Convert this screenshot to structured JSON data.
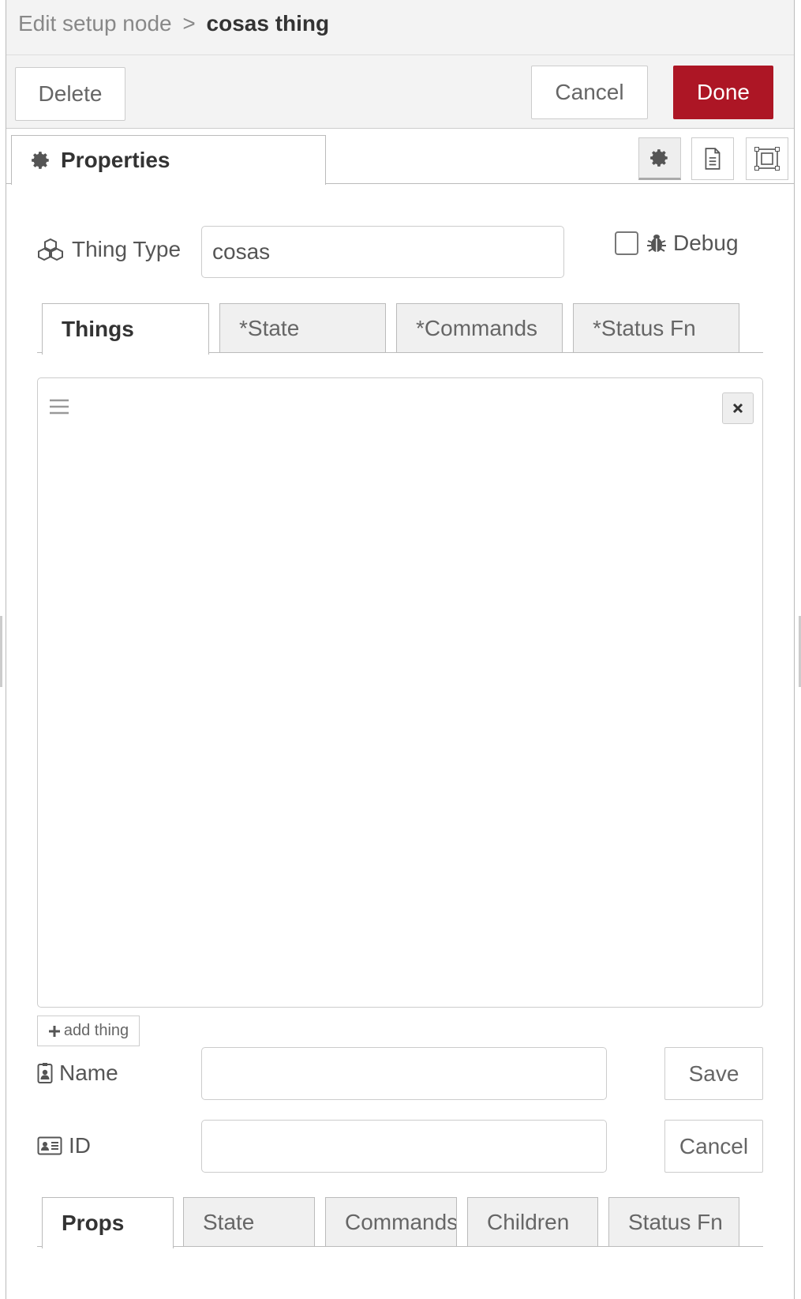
{
  "header": {
    "breadcrumb_prefix": "Edit setup node",
    "separator": ">",
    "node_name": "cosas thing"
  },
  "toolbar": {
    "delete_label": "Delete",
    "cancel_label": "Cancel",
    "done_label": "Done"
  },
  "properties_tab": {
    "label": "Properties",
    "icon": "gear-icon"
  },
  "tray_icons": [
    "gear-icon",
    "document-icon",
    "frame-icon"
  ],
  "thing_type": {
    "label": "Thing Type",
    "icon": "cubes-icon",
    "value": "cosas"
  },
  "debug": {
    "label": "Debug",
    "icon": "bug-icon",
    "checked": false
  },
  "top_tabs": [
    {
      "label": "Things",
      "active": true
    },
    {
      "label": "*State",
      "active": false
    },
    {
      "label": "*Commands",
      "active": false
    },
    {
      "label": "*Status Fn",
      "active": false
    }
  ],
  "things_list": {
    "handle_icon": "bars-icon",
    "remove_icon": "times-icon",
    "items": []
  },
  "add_thing": {
    "label": "add thing",
    "icon": "plus-icon"
  },
  "name_field": {
    "label": "Name",
    "icon": "id-badge-icon",
    "value": "",
    "save_label": "Save"
  },
  "id_field": {
    "label": "ID",
    "icon": "id-card-icon",
    "value": "",
    "cancel_label": "Cancel"
  },
  "bottom_tabs": [
    {
      "label": "Props",
      "active": true
    },
    {
      "label": "State",
      "active": false
    },
    {
      "label": "Commands",
      "active": false
    },
    {
      "label": "Children",
      "active": false
    },
    {
      "label": "Status Fn",
      "active": false
    }
  ],
  "colors": {
    "done_button": "#ad1625",
    "header_bg": "#f3f3f3",
    "border": "#cccccc"
  }
}
